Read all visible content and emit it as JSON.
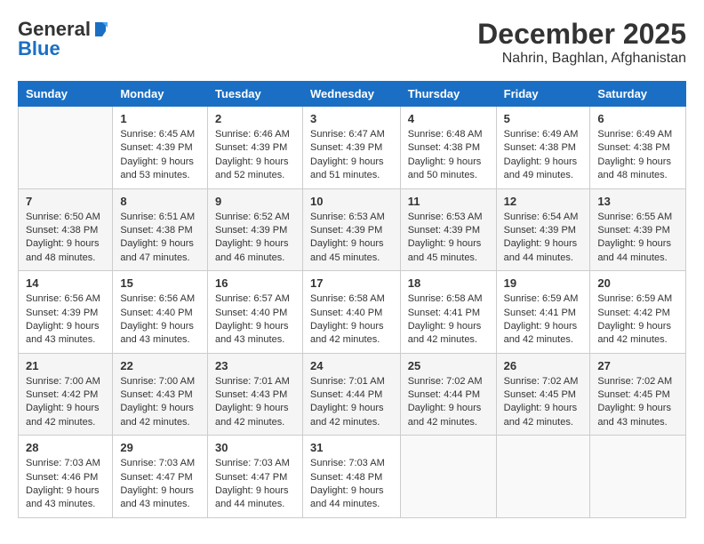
{
  "header": {
    "logo_general": "General",
    "logo_blue": "Blue",
    "month": "December 2025",
    "location": "Nahrin, Baghlan, Afghanistan"
  },
  "weekdays": [
    "Sunday",
    "Monday",
    "Tuesday",
    "Wednesday",
    "Thursday",
    "Friday",
    "Saturday"
  ],
  "weeks": [
    [
      {
        "day": "",
        "sunrise": "",
        "sunset": "",
        "daylight": "",
        "empty": true
      },
      {
        "day": "1",
        "sunrise": "Sunrise: 6:45 AM",
        "sunset": "Sunset: 4:39 PM",
        "daylight": "Daylight: 9 hours and 53 minutes."
      },
      {
        "day": "2",
        "sunrise": "Sunrise: 6:46 AM",
        "sunset": "Sunset: 4:39 PM",
        "daylight": "Daylight: 9 hours and 52 minutes."
      },
      {
        "day": "3",
        "sunrise": "Sunrise: 6:47 AM",
        "sunset": "Sunset: 4:39 PM",
        "daylight": "Daylight: 9 hours and 51 minutes."
      },
      {
        "day": "4",
        "sunrise": "Sunrise: 6:48 AM",
        "sunset": "Sunset: 4:38 PM",
        "daylight": "Daylight: 9 hours and 50 minutes."
      },
      {
        "day": "5",
        "sunrise": "Sunrise: 6:49 AM",
        "sunset": "Sunset: 4:38 PM",
        "daylight": "Daylight: 9 hours and 49 minutes."
      },
      {
        "day": "6",
        "sunrise": "Sunrise: 6:49 AM",
        "sunset": "Sunset: 4:38 PM",
        "daylight": "Daylight: 9 hours and 48 minutes."
      }
    ],
    [
      {
        "day": "7",
        "sunrise": "Sunrise: 6:50 AM",
        "sunset": "Sunset: 4:38 PM",
        "daylight": "Daylight: 9 hours and 48 minutes."
      },
      {
        "day": "8",
        "sunrise": "Sunrise: 6:51 AM",
        "sunset": "Sunset: 4:38 PM",
        "daylight": "Daylight: 9 hours and 47 minutes."
      },
      {
        "day": "9",
        "sunrise": "Sunrise: 6:52 AM",
        "sunset": "Sunset: 4:39 PM",
        "daylight": "Daylight: 9 hours and 46 minutes."
      },
      {
        "day": "10",
        "sunrise": "Sunrise: 6:53 AM",
        "sunset": "Sunset: 4:39 PM",
        "daylight": "Daylight: 9 hours and 45 minutes."
      },
      {
        "day": "11",
        "sunrise": "Sunrise: 6:53 AM",
        "sunset": "Sunset: 4:39 PM",
        "daylight": "Daylight: 9 hours and 45 minutes."
      },
      {
        "day": "12",
        "sunrise": "Sunrise: 6:54 AM",
        "sunset": "Sunset: 4:39 PM",
        "daylight": "Daylight: 9 hours and 44 minutes."
      },
      {
        "day": "13",
        "sunrise": "Sunrise: 6:55 AM",
        "sunset": "Sunset: 4:39 PM",
        "daylight": "Daylight: 9 hours and 44 minutes."
      }
    ],
    [
      {
        "day": "14",
        "sunrise": "Sunrise: 6:56 AM",
        "sunset": "Sunset: 4:39 PM",
        "daylight": "Daylight: 9 hours and 43 minutes."
      },
      {
        "day": "15",
        "sunrise": "Sunrise: 6:56 AM",
        "sunset": "Sunset: 4:40 PM",
        "daylight": "Daylight: 9 hours and 43 minutes."
      },
      {
        "day": "16",
        "sunrise": "Sunrise: 6:57 AM",
        "sunset": "Sunset: 4:40 PM",
        "daylight": "Daylight: 9 hours and 43 minutes."
      },
      {
        "day": "17",
        "sunrise": "Sunrise: 6:58 AM",
        "sunset": "Sunset: 4:40 PM",
        "daylight": "Daylight: 9 hours and 42 minutes."
      },
      {
        "day": "18",
        "sunrise": "Sunrise: 6:58 AM",
        "sunset": "Sunset: 4:41 PM",
        "daylight": "Daylight: 9 hours and 42 minutes."
      },
      {
        "day": "19",
        "sunrise": "Sunrise: 6:59 AM",
        "sunset": "Sunset: 4:41 PM",
        "daylight": "Daylight: 9 hours and 42 minutes."
      },
      {
        "day": "20",
        "sunrise": "Sunrise: 6:59 AM",
        "sunset": "Sunset: 4:42 PM",
        "daylight": "Daylight: 9 hours and 42 minutes."
      }
    ],
    [
      {
        "day": "21",
        "sunrise": "Sunrise: 7:00 AM",
        "sunset": "Sunset: 4:42 PM",
        "daylight": "Daylight: 9 hours and 42 minutes."
      },
      {
        "day": "22",
        "sunrise": "Sunrise: 7:00 AM",
        "sunset": "Sunset: 4:43 PM",
        "daylight": "Daylight: 9 hours and 42 minutes."
      },
      {
        "day": "23",
        "sunrise": "Sunrise: 7:01 AM",
        "sunset": "Sunset: 4:43 PM",
        "daylight": "Daylight: 9 hours and 42 minutes."
      },
      {
        "day": "24",
        "sunrise": "Sunrise: 7:01 AM",
        "sunset": "Sunset: 4:44 PM",
        "daylight": "Daylight: 9 hours and 42 minutes."
      },
      {
        "day": "25",
        "sunrise": "Sunrise: 7:02 AM",
        "sunset": "Sunset: 4:44 PM",
        "daylight": "Daylight: 9 hours and 42 minutes."
      },
      {
        "day": "26",
        "sunrise": "Sunrise: 7:02 AM",
        "sunset": "Sunset: 4:45 PM",
        "daylight": "Daylight: 9 hours and 42 minutes."
      },
      {
        "day": "27",
        "sunrise": "Sunrise: 7:02 AM",
        "sunset": "Sunset: 4:45 PM",
        "daylight": "Daylight: 9 hours and 43 minutes."
      }
    ],
    [
      {
        "day": "28",
        "sunrise": "Sunrise: 7:03 AM",
        "sunset": "Sunset: 4:46 PM",
        "daylight": "Daylight: 9 hours and 43 minutes."
      },
      {
        "day": "29",
        "sunrise": "Sunrise: 7:03 AM",
        "sunset": "Sunset: 4:47 PM",
        "daylight": "Daylight: 9 hours and 43 minutes."
      },
      {
        "day": "30",
        "sunrise": "Sunrise: 7:03 AM",
        "sunset": "Sunset: 4:47 PM",
        "daylight": "Daylight: 9 hours and 44 minutes."
      },
      {
        "day": "31",
        "sunrise": "Sunrise: 7:03 AM",
        "sunset": "Sunset: 4:48 PM",
        "daylight": "Daylight: 9 hours and 44 minutes."
      },
      {
        "day": "",
        "sunrise": "",
        "sunset": "",
        "daylight": "",
        "empty": true
      },
      {
        "day": "",
        "sunrise": "",
        "sunset": "",
        "daylight": "",
        "empty": true
      },
      {
        "day": "",
        "sunrise": "",
        "sunset": "",
        "daylight": "",
        "empty": true
      }
    ]
  ]
}
